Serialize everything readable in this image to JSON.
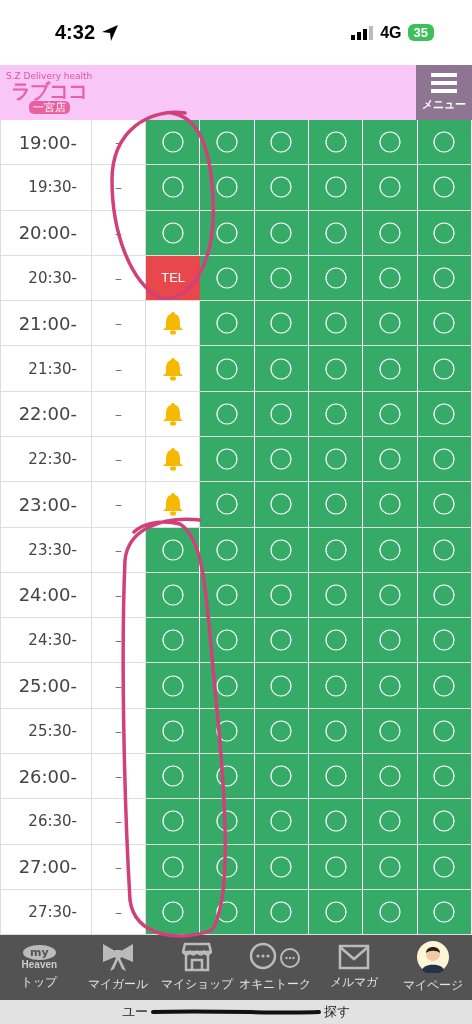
{
  "status_bar": {
    "time": "4:32",
    "network": "4G",
    "battery": "35"
  },
  "header": {
    "logo": {
      "tagline": "S.Z Delivery health",
      "name": "ラブココ",
      "branch": "一宮店"
    },
    "menu_label": "メニュー"
  },
  "schedule": [
    {
      "time": "19:00-",
      "half": false,
      "dash": "–",
      "cells": [
        {
          "kind": "open"
        },
        {
          "kind": "open"
        },
        {
          "kind": "open"
        },
        {
          "kind": "open"
        },
        {
          "kind": "open"
        },
        {
          "kind": "open"
        }
      ]
    },
    {
      "time": "19:30-",
      "half": true,
      "dash": "–",
      "cells": [
        {
          "kind": "open"
        },
        {
          "kind": "open"
        },
        {
          "kind": "open"
        },
        {
          "kind": "open"
        },
        {
          "kind": "open"
        },
        {
          "kind": "open"
        }
      ]
    },
    {
      "time": "20:00-",
      "half": false,
      "dash": "–",
      "cells": [
        {
          "kind": "open"
        },
        {
          "kind": "open"
        },
        {
          "kind": "open"
        },
        {
          "kind": "open"
        },
        {
          "kind": "open"
        },
        {
          "kind": "open"
        }
      ]
    },
    {
      "time": "20:30-",
      "half": true,
      "dash": "–",
      "cells": [
        {
          "kind": "tel",
          "label": "TEL"
        },
        {
          "kind": "open"
        },
        {
          "kind": "open"
        },
        {
          "kind": "open"
        },
        {
          "kind": "open"
        },
        {
          "kind": "open"
        }
      ]
    },
    {
      "time": "21:00-",
      "half": false,
      "dash": "–",
      "cells": [
        {
          "kind": "bell"
        },
        {
          "kind": "open"
        },
        {
          "kind": "open"
        },
        {
          "kind": "open"
        },
        {
          "kind": "open"
        },
        {
          "kind": "open"
        }
      ]
    },
    {
      "time": "21:30-",
      "half": true,
      "dash": "–",
      "cells": [
        {
          "kind": "bell"
        },
        {
          "kind": "open"
        },
        {
          "kind": "open"
        },
        {
          "kind": "open"
        },
        {
          "kind": "open"
        },
        {
          "kind": "open"
        }
      ]
    },
    {
      "time": "22:00-",
      "half": false,
      "dash": "–",
      "cells": [
        {
          "kind": "bell"
        },
        {
          "kind": "open"
        },
        {
          "kind": "open"
        },
        {
          "kind": "open"
        },
        {
          "kind": "open"
        },
        {
          "kind": "open"
        }
      ]
    },
    {
      "time": "22:30-",
      "half": true,
      "dash": "–",
      "cells": [
        {
          "kind": "bell"
        },
        {
          "kind": "open"
        },
        {
          "kind": "open"
        },
        {
          "kind": "open"
        },
        {
          "kind": "open"
        },
        {
          "kind": "open"
        }
      ]
    },
    {
      "time": "23:00-",
      "half": false,
      "dash": "–",
      "cells": [
        {
          "kind": "bell"
        },
        {
          "kind": "open"
        },
        {
          "kind": "open"
        },
        {
          "kind": "open"
        },
        {
          "kind": "open"
        },
        {
          "kind": "open"
        }
      ]
    },
    {
      "time": "23:30-",
      "half": true,
      "dash": "–",
      "cells": [
        {
          "kind": "open"
        },
        {
          "kind": "open"
        },
        {
          "kind": "open"
        },
        {
          "kind": "open"
        },
        {
          "kind": "open"
        },
        {
          "kind": "open"
        }
      ]
    },
    {
      "time": "24:00-",
      "half": false,
      "dash": "–",
      "cells": [
        {
          "kind": "open"
        },
        {
          "kind": "open"
        },
        {
          "kind": "open"
        },
        {
          "kind": "open"
        },
        {
          "kind": "open"
        },
        {
          "kind": "open"
        }
      ]
    },
    {
      "time": "24:30-",
      "half": true,
      "dash": "–",
      "cells": [
        {
          "kind": "open"
        },
        {
          "kind": "open"
        },
        {
          "kind": "open"
        },
        {
          "kind": "open"
        },
        {
          "kind": "open"
        },
        {
          "kind": "open"
        }
      ]
    },
    {
      "time": "25:00-",
      "half": false,
      "dash": "–",
      "cells": [
        {
          "kind": "open"
        },
        {
          "kind": "open"
        },
        {
          "kind": "open"
        },
        {
          "kind": "open"
        },
        {
          "kind": "open"
        },
        {
          "kind": "open"
        }
      ]
    },
    {
      "time": "25:30-",
      "half": true,
      "dash": "–",
      "cells": [
        {
          "kind": "open"
        },
        {
          "kind": "open"
        },
        {
          "kind": "open"
        },
        {
          "kind": "open"
        },
        {
          "kind": "open"
        },
        {
          "kind": "open"
        }
      ]
    },
    {
      "time": "26:00-",
      "half": false,
      "dash": "–",
      "cells": [
        {
          "kind": "open"
        },
        {
          "kind": "open"
        },
        {
          "kind": "open"
        },
        {
          "kind": "open"
        },
        {
          "kind": "open"
        },
        {
          "kind": "open"
        }
      ]
    },
    {
      "time": "26:30-",
      "half": true,
      "dash": "–",
      "cells": [
        {
          "kind": "open"
        },
        {
          "kind": "open"
        },
        {
          "kind": "open"
        },
        {
          "kind": "open"
        },
        {
          "kind": "open"
        },
        {
          "kind": "open"
        }
      ]
    },
    {
      "time": "27:00-",
      "half": false,
      "dash": "–",
      "cells": [
        {
          "kind": "open"
        },
        {
          "kind": "open"
        },
        {
          "kind": "open"
        },
        {
          "kind": "open"
        },
        {
          "kind": "open"
        },
        {
          "kind": "open"
        }
      ]
    },
    {
      "time": "27:30-",
      "half": true,
      "dash": "–",
      "cells": [
        {
          "kind": "open"
        },
        {
          "kind": "open"
        },
        {
          "kind": "open"
        },
        {
          "kind": "open"
        },
        {
          "kind": "open"
        },
        {
          "kind": "open"
        }
      ]
    }
  ],
  "bottom_nav": [
    {
      "kind": "heaven",
      "icon_text": [
        "my",
        "Heaven"
      ],
      "label": "トップ"
    },
    {
      "kind": "bow",
      "label": "マイガール"
    },
    {
      "kind": "shop",
      "label": "マイショップ"
    },
    {
      "kind": "chat",
      "label": "オキニトーク"
    },
    {
      "kind": "mail",
      "label": "メルマガ"
    },
    {
      "kind": "avatar",
      "label": "マイページ"
    }
  ],
  "footer_link": {
    "start": "ユー",
    "end": "探す"
  },
  "annotations": [
    {
      "kind": "loop"
    },
    {
      "kind": "loop"
    },
    {
      "kind": "strike"
    }
  ]
}
